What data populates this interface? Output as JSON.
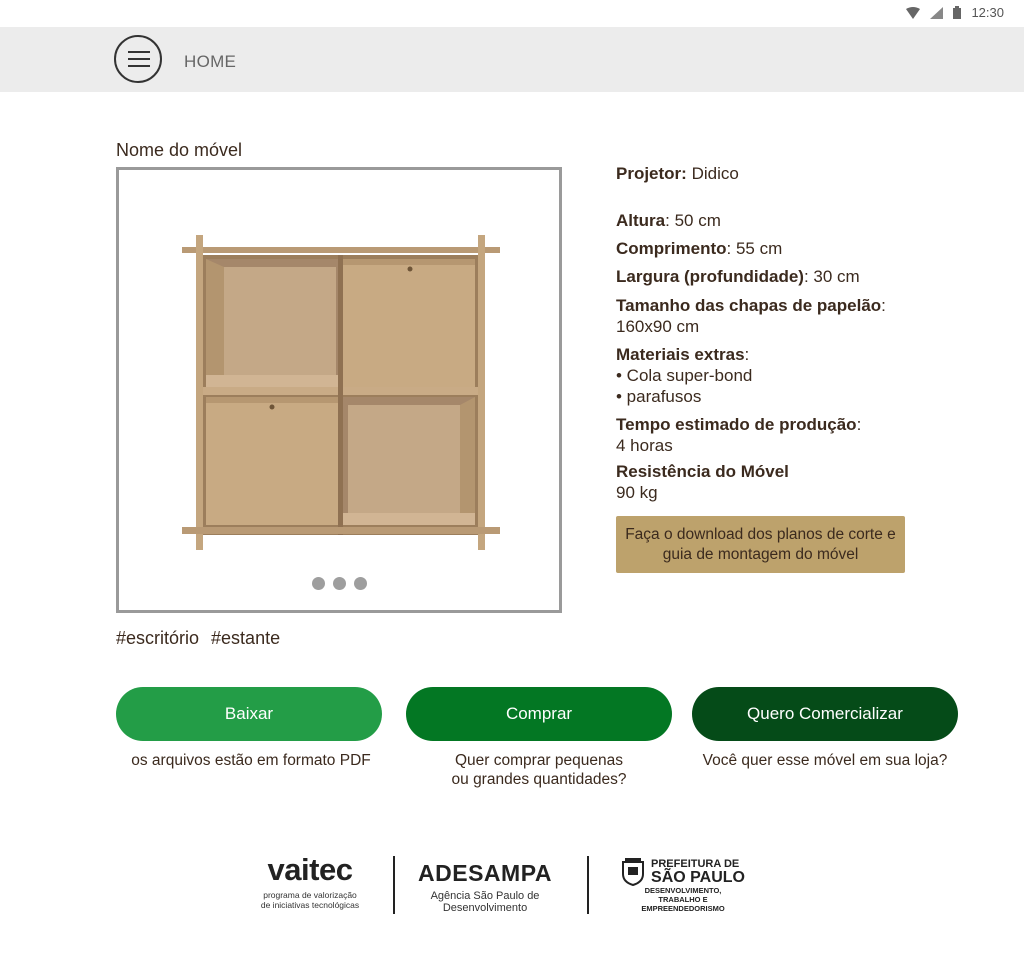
{
  "status_bar": {
    "time": "12:30"
  },
  "header": {
    "home_label": "HOME"
  },
  "product": {
    "name": "Nome do móvel",
    "carousel_dots": 3
  },
  "specs": {
    "projetor_label": "Projetor:",
    "projetor_value": " Didico",
    "altura_label": "Altura",
    "altura_value": ": 50 cm",
    "comprimento_label": "Comprimento",
    "comprimento_value": ": 55 cm",
    "largura_label": "Largura (profundidade)",
    "largura_value": ": 30 cm",
    "chapas_label": "Tamanho das chapas de papelão",
    "chapas_colon": ":",
    "chapas_value": "160x90 cm",
    "materiais_label": "Materiais extras",
    "materiais_colon": ":",
    "materiais_items": [
      "• Cola super-bond",
      "• parafusos"
    ],
    "tempo_label": "Tempo estimado de produção",
    "tempo_colon": ":",
    "tempo_value": "4 horas",
    "resistencia_label": "Resistência do Móvel",
    "resistencia_value": "90 kg",
    "download_label": "Faça o download dos planos de corte e guia de montagem do móvel"
  },
  "tags": [
    "#escritório",
    "#estante"
  ],
  "actions": [
    {
      "label": "Baixar",
      "note": "os arquivos estão em formato PDF"
    },
    {
      "label": "Comprar",
      "note_line1": "Quer comprar pequenas",
      "note_line2": "ou grandes quantidades?"
    },
    {
      "label": "Quero Comercializar",
      "note": "Você quer esse móvel em sua loja?"
    }
  ],
  "footer": {
    "vaitec": {
      "name": "vaitec",
      "sub_line1": "programa de valorização",
      "sub_line2": "de iniciativas tecnológicas"
    },
    "adesampa": {
      "name": "ADESAMPA",
      "sub_line1": "Agência São Paulo de",
      "sub_line2": "Desenvolvimento"
    },
    "prefeitura": {
      "line1": "PREFEITURA DE",
      "line2": "SÃO PAULO",
      "line3": "DESENVOLVIMENTO,",
      "line4": "TRABALHO E EMPREENDEDORISMO"
    }
  },
  "colors": {
    "baixar": "#239d47",
    "comprar": "#037723",
    "comercializar": "#054b18",
    "download": "#bda26c",
    "header_bg": "#ececec",
    "text": "#3b2a1e"
  },
  "icons": [
    "wifi-icon",
    "signal-icon",
    "battery-icon",
    "menu-icon"
  ]
}
